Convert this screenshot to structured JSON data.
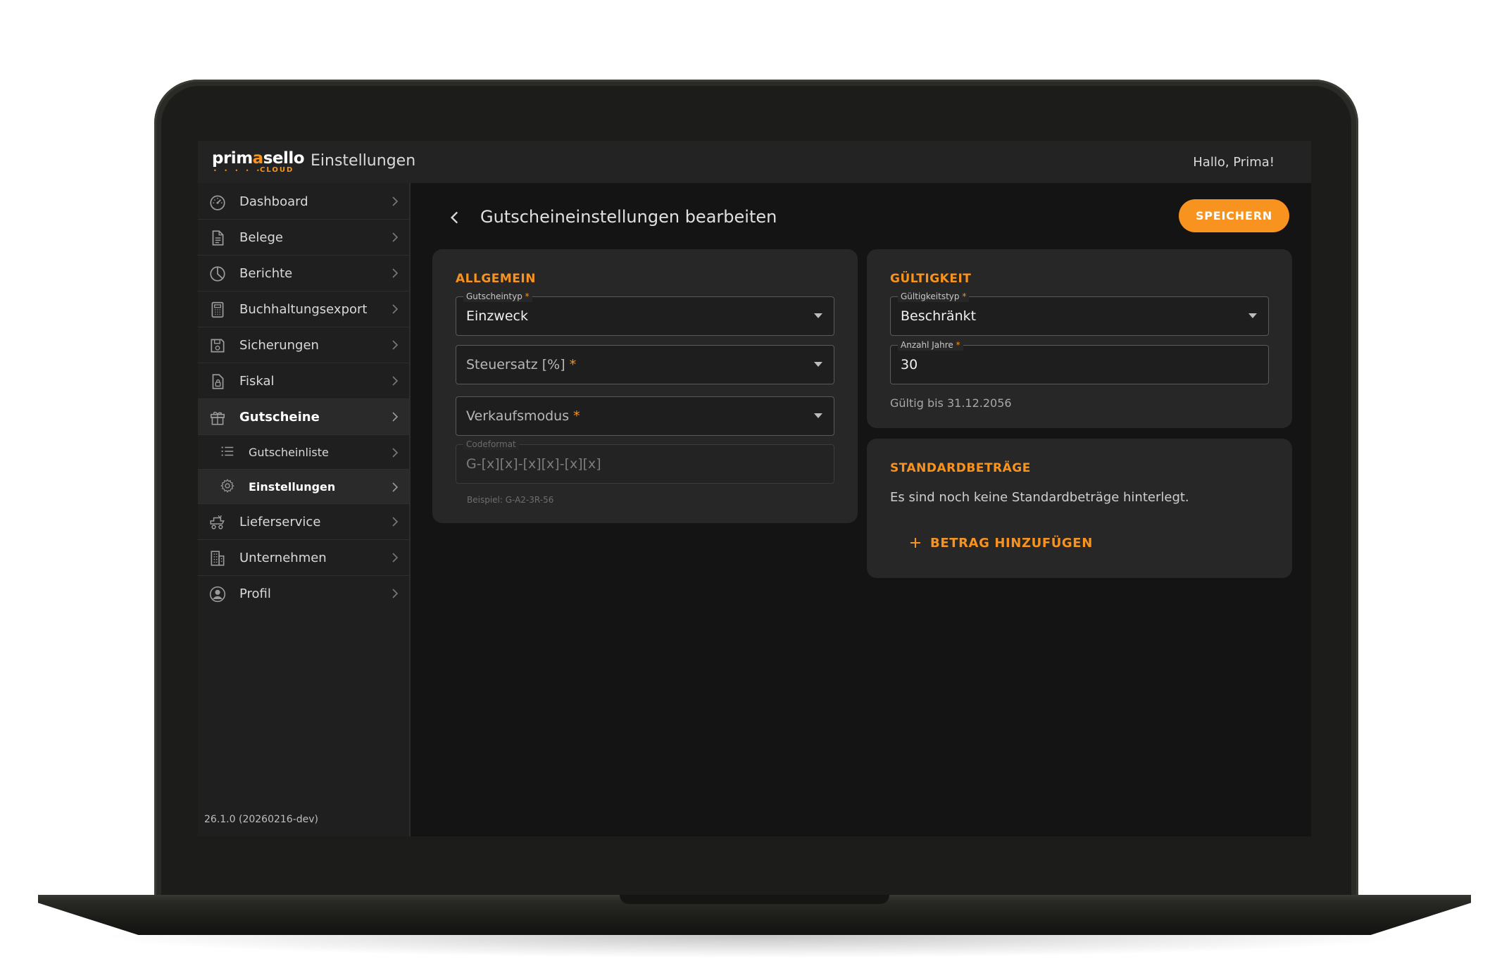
{
  "app": {
    "logo_text_left": "prim",
    "logo_text_accent": "a",
    "logo_text_right": "sello",
    "logo_dots": "• • • • •",
    "logo_sub": "CLOUD",
    "title": "Einstellungen",
    "greeting": "Hallo, Prima!"
  },
  "sidebar": {
    "items": [
      {
        "label": "Dashboard",
        "icon": "dashboard-gauge-icon"
      },
      {
        "label": "Belege",
        "icon": "document-icon"
      },
      {
        "label": "Berichte",
        "icon": "pie-chart-icon"
      },
      {
        "label": "Buchhaltungsexport",
        "icon": "calculator-icon"
      },
      {
        "label": "Sicherungen",
        "icon": "save-disk-icon"
      },
      {
        "label": "Fiskal",
        "icon": "fiscal-document-icon"
      },
      {
        "label": "Gutscheine",
        "icon": "gift-icon"
      },
      {
        "label": "Gutscheinliste",
        "icon": "list-icon"
      },
      {
        "label": "Einstellungen",
        "icon": "gear-icon"
      },
      {
        "label": "Lieferservice",
        "icon": "delivery-icon"
      },
      {
        "label": "Unternehmen",
        "icon": "building-icon"
      },
      {
        "label": "Profil",
        "icon": "user-circle-icon"
      }
    ],
    "version": "26.1.0 (20260216-dev)"
  },
  "page": {
    "title": "Gutscheineinstellungen bearbeiten",
    "save_label": "SPEICHERN"
  },
  "allgemein": {
    "title": "ALLGEMEIN",
    "gutscheintyp_label": "Gutscheintyp",
    "gutscheintyp_value": "Einzweck",
    "steuersatz_placeholder": "Steuersatz [%]",
    "verkaufsmodus_placeholder": "Verkaufsmodus",
    "codeformat_label": "Codeformat",
    "codeformat_value": "G-[x][x]-[x][x]-[x][x]",
    "codeformat_example": "Beispiel: G-A2-3R-56",
    "required_mark": "*"
  },
  "gueltigkeit": {
    "title": "GÜLTIGKEIT",
    "typ_label": "Gültigkeitstyp",
    "typ_value": "Beschränkt",
    "jahre_label": "Anzahl Jahre",
    "jahre_value": "30",
    "valid_until": "Gültig bis 31.12.2056"
  },
  "standardbetraege": {
    "title": "STANDARDBETRÄGE",
    "empty_text": "Es sind noch keine Standardbeträge hinterlegt.",
    "add_label": "BETRAG HINZUFÜGEN"
  },
  "colors": {
    "accent": "#f7931e",
    "background": "#141414",
    "card": "#272727",
    "sidebar": "#1f1f1f"
  }
}
